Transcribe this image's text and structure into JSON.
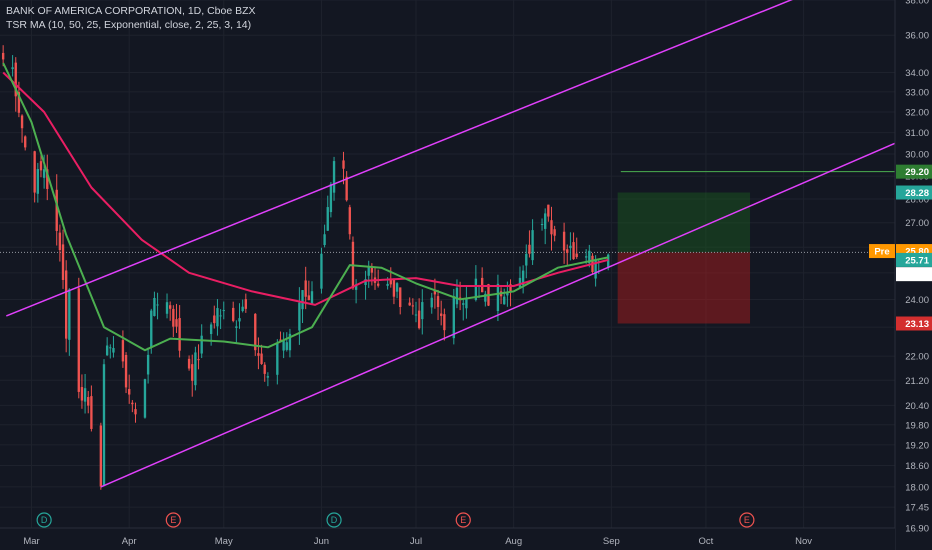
{
  "header": {
    "title": "BANK OF AMERICA CORPORATION, 1D, Cboe BZX",
    "indicator": "TSR MA (10, 50, 25, Exponential, close, 2, 25, 3, 14)"
  },
  "colors": {
    "background": "#131722",
    "up": "#26a69a",
    "down": "#ef5350",
    "ma_fast": "#4caf50",
    "ma_slow": "#e91e63",
    "channel": "#e040fb",
    "profit_zone": "#1b5e20",
    "loss_zone": "#b71c1c",
    "pre_tag": "#ff9800"
  },
  "chart_data": {
    "type": "candlestick",
    "y_axis": {
      "ticks": [
        "16.90",
        "17.45",
        "18.00",
        "18.60",
        "19.20",
        "19.80",
        "20.40",
        "21.20",
        "22.00",
        "23.00",
        "24.00",
        "25.00",
        "26.00",
        "27.00",
        "28.00",
        "29.00",
        "30.00",
        "31.00",
        "32.00",
        "33.00",
        "34.00",
        "36.00",
        "38.00"
      ],
      "range": [
        16.9,
        38.0
      ],
      "scale": "log"
    },
    "x_axis": {
      "labels": [
        "Mar",
        "Apr",
        "May",
        "Jun",
        "Jul",
        "Aug",
        "Sep",
        "Oct",
        "Nov"
      ],
      "label_dates": [
        "2020-03-01",
        "2020-04-01",
        "2020-05-01",
        "2020-06-01",
        "2020-07-01",
        "2020-08-01",
        "2020-09-01",
        "2020-10-01",
        "2020-11-01"
      ],
      "range": [
        "2020-02-20",
        "2020-11-30"
      ]
    },
    "anchors": [
      [
        "2020-02-21",
        34.7
      ],
      [
        "2020-02-24",
        34.2
      ],
      [
        "2020-02-28",
        30.3
      ],
      [
        "2020-03-02",
        28.7
      ],
      [
        "2020-03-05",
        29.4
      ],
      [
        "2020-03-09",
        26.4
      ],
      [
        "2020-03-11",
        25.1
      ],
      [
        "2020-03-12",
        22.6
      ],
      [
        "2020-03-13",
        24.6
      ],
      [
        "2020-03-16",
        20.7
      ],
      [
        "2020-03-18",
        20.9
      ],
      [
        "2020-03-20",
        19.9
      ],
      [
        "2020-03-23",
        18.3
      ],
      [
        "2020-03-24",
        21.4
      ],
      [
        "2020-03-26",
        22.6
      ],
      [
        "2020-03-31",
        21.2
      ],
      [
        "2020-04-03",
        20.0
      ],
      [
        "2020-04-06",
        21.4
      ],
      [
        "2020-04-09",
        24.1
      ],
      [
        "2020-04-14",
        23.8
      ],
      [
        "2020-04-17",
        22.3
      ],
      [
        "2020-04-21",
        21.5
      ],
      [
        "2020-04-24",
        22.4
      ],
      [
        "2020-04-29",
        23.6
      ],
      [
        "2020-05-04",
        23.1
      ],
      [
        "2020-05-08",
        24.0
      ],
      [
        "2020-05-13",
        21.6
      ],
      [
        "2020-05-15",
        21.0
      ],
      [
        "2020-05-18",
        22.6
      ],
      [
        "2020-05-22",
        22.5
      ],
      [
        "2020-05-26",
        24.4
      ],
      [
        "2020-05-29",
        24.1
      ],
      [
        "2020-06-03",
        27.4
      ],
      [
        "2020-06-05",
        29.2
      ],
      [
        "2020-06-08",
        28.9
      ],
      [
        "2020-06-10",
        26.3
      ],
      [
        "2020-06-11",
        24.3
      ],
      [
        "2020-06-16",
        25.4
      ],
      [
        "2020-06-19",
        24.6
      ],
      [
        "2020-06-24",
        24.3
      ],
      [
        "2020-06-29",
        23.9
      ],
      [
        "2020-07-02",
        23.3
      ],
      [
        "2020-07-06",
        24.1
      ],
      [
        "2020-07-10",
        23.2
      ],
      [
        "2020-07-14",
        24.1
      ],
      [
        "2020-07-20",
        24.6
      ],
      [
        "2020-07-23",
        23.9
      ],
      [
        "2020-07-27",
        24.3
      ],
      [
        "2020-07-31",
        24.7
      ],
      [
        "2020-08-04",
        24.8
      ],
      [
        "2020-08-07",
        26.7
      ],
      [
        "2020-08-11",
        27.6
      ],
      [
        "2020-08-14",
        26.6
      ],
      [
        "2020-08-19",
        25.8
      ],
      [
        "2020-08-24",
        26.1
      ],
      [
        "2020-08-26",
        25.4
      ],
      [
        "2020-08-28",
        25.8
      ],
      [
        "2020-08-31",
        25.71
      ]
    ],
    "ma_fast": [
      [
        "2020-02-21",
        34.5
      ],
      [
        "2020-03-01",
        31.5
      ],
      [
        "2020-03-12",
        26.5
      ],
      [
        "2020-03-24",
        23.0
      ],
      [
        "2020-04-06",
        22.2
      ],
      [
        "2020-04-14",
        22.6
      ],
      [
        "2020-05-01",
        22.5
      ],
      [
        "2020-05-15",
        22.3
      ],
      [
        "2020-05-29",
        23.0
      ],
      [
        "2020-06-10",
        25.3
      ],
      [
        "2020-06-20",
        25.2
      ],
      [
        "2020-07-01",
        24.6
      ],
      [
        "2020-07-15",
        24.0
      ],
      [
        "2020-08-01",
        24.3
      ],
      [
        "2020-08-15",
        25.2
      ],
      [
        "2020-08-31",
        25.6
      ]
    ],
    "ma_slow": [
      [
        "2020-02-21",
        34.0
      ],
      [
        "2020-03-05",
        32.0
      ],
      [
        "2020-03-20",
        28.5
      ],
      [
        "2020-04-05",
        26.3
      ],
      [
        "2020-04-20",
        25.0
      ],
      [
        "2020-05-10",
        24.3
      ],
      [
        "2020-05-30",
        23.8
      ],
      [
        "2020-06-15",
        24.7
      ],
      [
        "2020-07-01",
        24.8
      ],
      [
        "2020-07-15",
        24.5
      ],
      [
        "2020-08-01",
        24.5
      ],
      [
        "2020-08-15",
        25.0
      ],
      [
        "2020-08-31",
        25.5
      ]
    ],
    "channel_upper": {
      "start": [
        "2020-02-22",
        23.4
      ],
      "end": [
        "2020-11-01",
        38.3
      ]
    },
    "channel_lower": {
      "start": [
        "2020-03-23",
        18.0
      ],
      "end": [
        "2020-11-30",
        30.5
      ]
    },
    "long_position": {
      "start": "2020-09-03",
      "end": "2020-10-15",
      "entry": 25.8,
      "target": 28.28,
      "stop": 23.13
    },
    "horizontal_level": {
      "start": "2020-09-04",
      "value": 29.2
    },
    "price_tags": [
      {
        "label": "29.20",
        "value": 29.2,
        "color": "#2e7d32"
      },
      {
        "label": "28.28",
        "value": 28.28,
        "color": "#26a69a"
      },
      {
        "label": "25.80",
        "value": 25.85,
        "color": "#ff9800",
        "prefix": "Pre"
      },
      {
        "label": "25.71",
        "value": 25.5,
        "color": "#26a69a"
      },
      {
        "label": "25.71",
        "value": 24.95,
        "color": "#ffffff"
      },
      {
        "label": "23.13",
        "value": 23.13,
        "color": "#d32f2f"
      }
    ],
    "events": [
      {
        "label": "D",
        "date": "2020-03-05",
        "color": "#26a69a"
      },
      {
        "label": "E",
        "date": "2020-04-15",
        "color": "#ef5350"
      },
      {
        "label": "D",
        "date": "2020-06-05",
        "color": "#26a69a"
      },
      {
        "label": "E",
        "date": "2020-07-16",
        "color": "#ef5350"
      },
      {
        "label": "E",
        "date": "2020-10-14",
        "color": "#ef5350"
      }
    ],
    "current_price": 25.8
  }
}
